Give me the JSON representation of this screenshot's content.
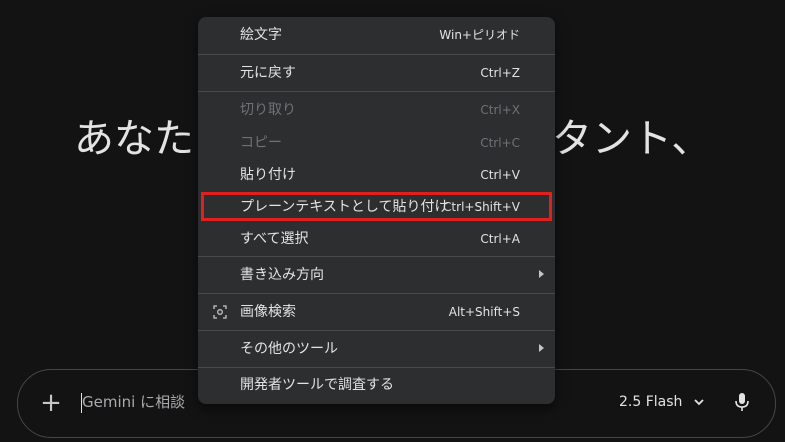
{
  "background": {
    "heading_left": "あなた",
    "heading_right": "タント、"
  },
  "prompt_bar": {
    "placeholder": "Gemini に相談",
    "model_label": "2.5 Flash",
    "add_icon": "plus-icon",
    "mic_icon": "mic-icon",
    "model_chevron_icon": "chevron-down-icon"
  },
  "context_menu": {
    "items": [
      {
        "label": "絵文字",
        "shortcut": "Win+ピリオド",
        "enabled": true
      },
      {
        "label": "元に戻す",
        "shortcut": "Ctrl+Z",
        "enabled": true
      },
      {
        "label": "切り取り",
        "shortcut": "Ctrl+X",
        "enabled": false
      },
      {
        "label": "コピー",
        "shortcut": "Ctrl+C",
        "enabled": false
      },
      {
        "label": "貼り付け",
        "shortcut": "Ctrl+V",
        "enabled": true
      },
      {
        "label": "プレーンテキストとして貼り付け",
        "shortcut": "Ctrl+Shift+V",
        "enabled": true,
        "highlighted": true
      },
      {
        "label": "すべて選択",
        "shortcut": "Ctrl+A",
        "enabled": true
      },
      {
        "label": "書き込み方向",
        "submenu": true,
        "enabled": true
      },
      {
        "label": "画像検索",
        "shortcut": "Alt+Shift+S",
        "icon": "lens-icon",
        "enabled": true
      },
      {
        "label": "その他のツール",
        "submenu": true,
        "enabled": true
      },
      {
        "label": "開発者ツールで調査する",
        "enabled": true
      }
    ]
  },
  "colors": {
    "background": "#131314",
    "menu": "#2d2e30",
    "highlight_border": "#e02020",
    "disabled_text": "#6f7175"
  }
}
